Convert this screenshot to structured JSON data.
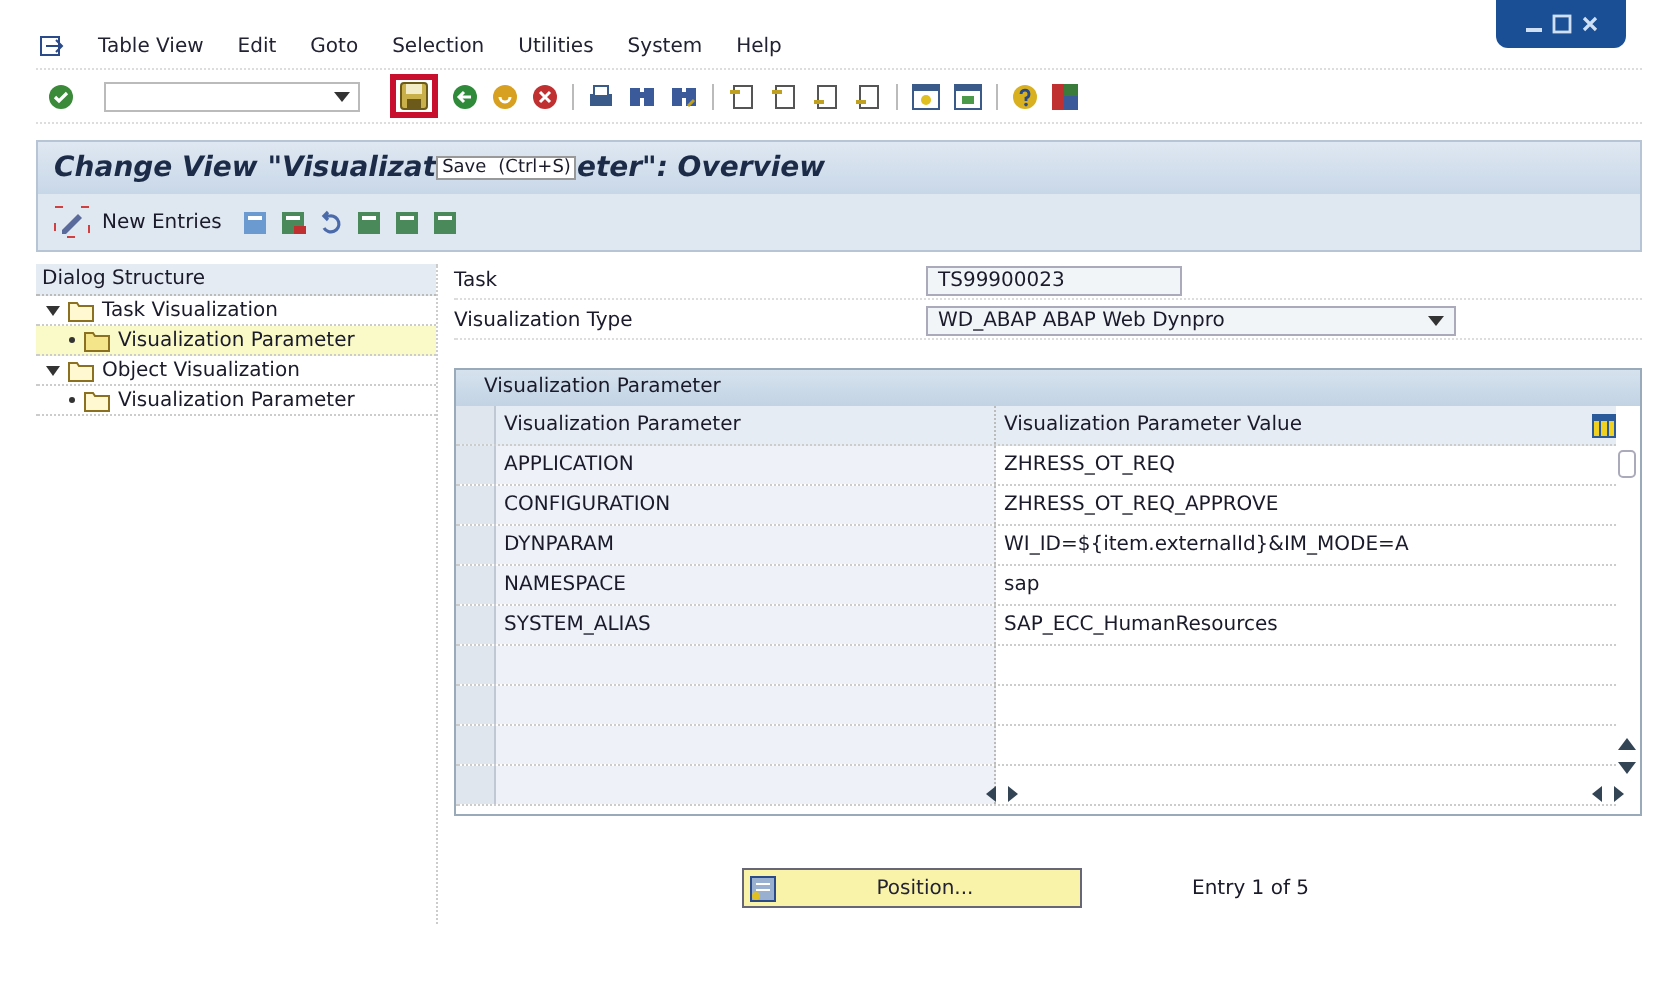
{
  "menu": [
    "Table View",
    "Edit",
    "Goto",
    "Selection",
    "Utilities",
    "System",
    "Help"
  ],
  "title": {
    "before": "Change View \"Visualizat",
    "after": "eter\": Overview"
  },
  "tooltip": {
    "label": "Save",
    "shortcut": "(Ctrl+S)"
  },
  "app_toolbar": {
    "new_entries": "New Entries"
  },
  "dialog_structure": {
    "title": "Dialog Structure",
    "items": [
      {
        "label": "Task Visualization",
        "expanded": true,
        "selected": false,
        "children": [
          {
            "label": "Visualization Parameter",
            "selected": true
          }
        ]
      },
      {
        "label": "Object Visualization",
        "expanded": true,
        "selected": false,
        "children": [
          {
            "label": "Visualization Parameter",
            "selected": false
          }
        ]
      }
    ]
  },
  "fields": [
    {
      "label": "Task",
      "value": "TS99900023",
      "kind": "text"
    },
    {
      "label": "Visualization Type",
      "value": "WD_ABAP ABAP Web Dynpro",
      "kind": "dropdown"
    }
  ],
  "table": {
    "title": "Visualization Parameter",
    "columns": [
      "Visualization Parameter",
      "Visualization Parameter Value"
    ],
    "rows": [
      [
        "APPLICATION",
        "ZHRESS_OT_REQ"
      ],
      [
        "CONFIGURATION",
        "ZHRESS_OT_REQ_APPROVE"
      ],
      [
        "DYNPARAM",
        "WI_ID=${item.externalId}&IM_MODE=A"
      ],
      [
        "NAMESPACE",
        "sap"
      ],
      [
        "SYSTEM_ALIAS",
        "SAP_ECC_HumanResources"
      ]
    ]
  },
  "position_button": "Position...",
  "entry_info": "Entry 1 of 5"
}
